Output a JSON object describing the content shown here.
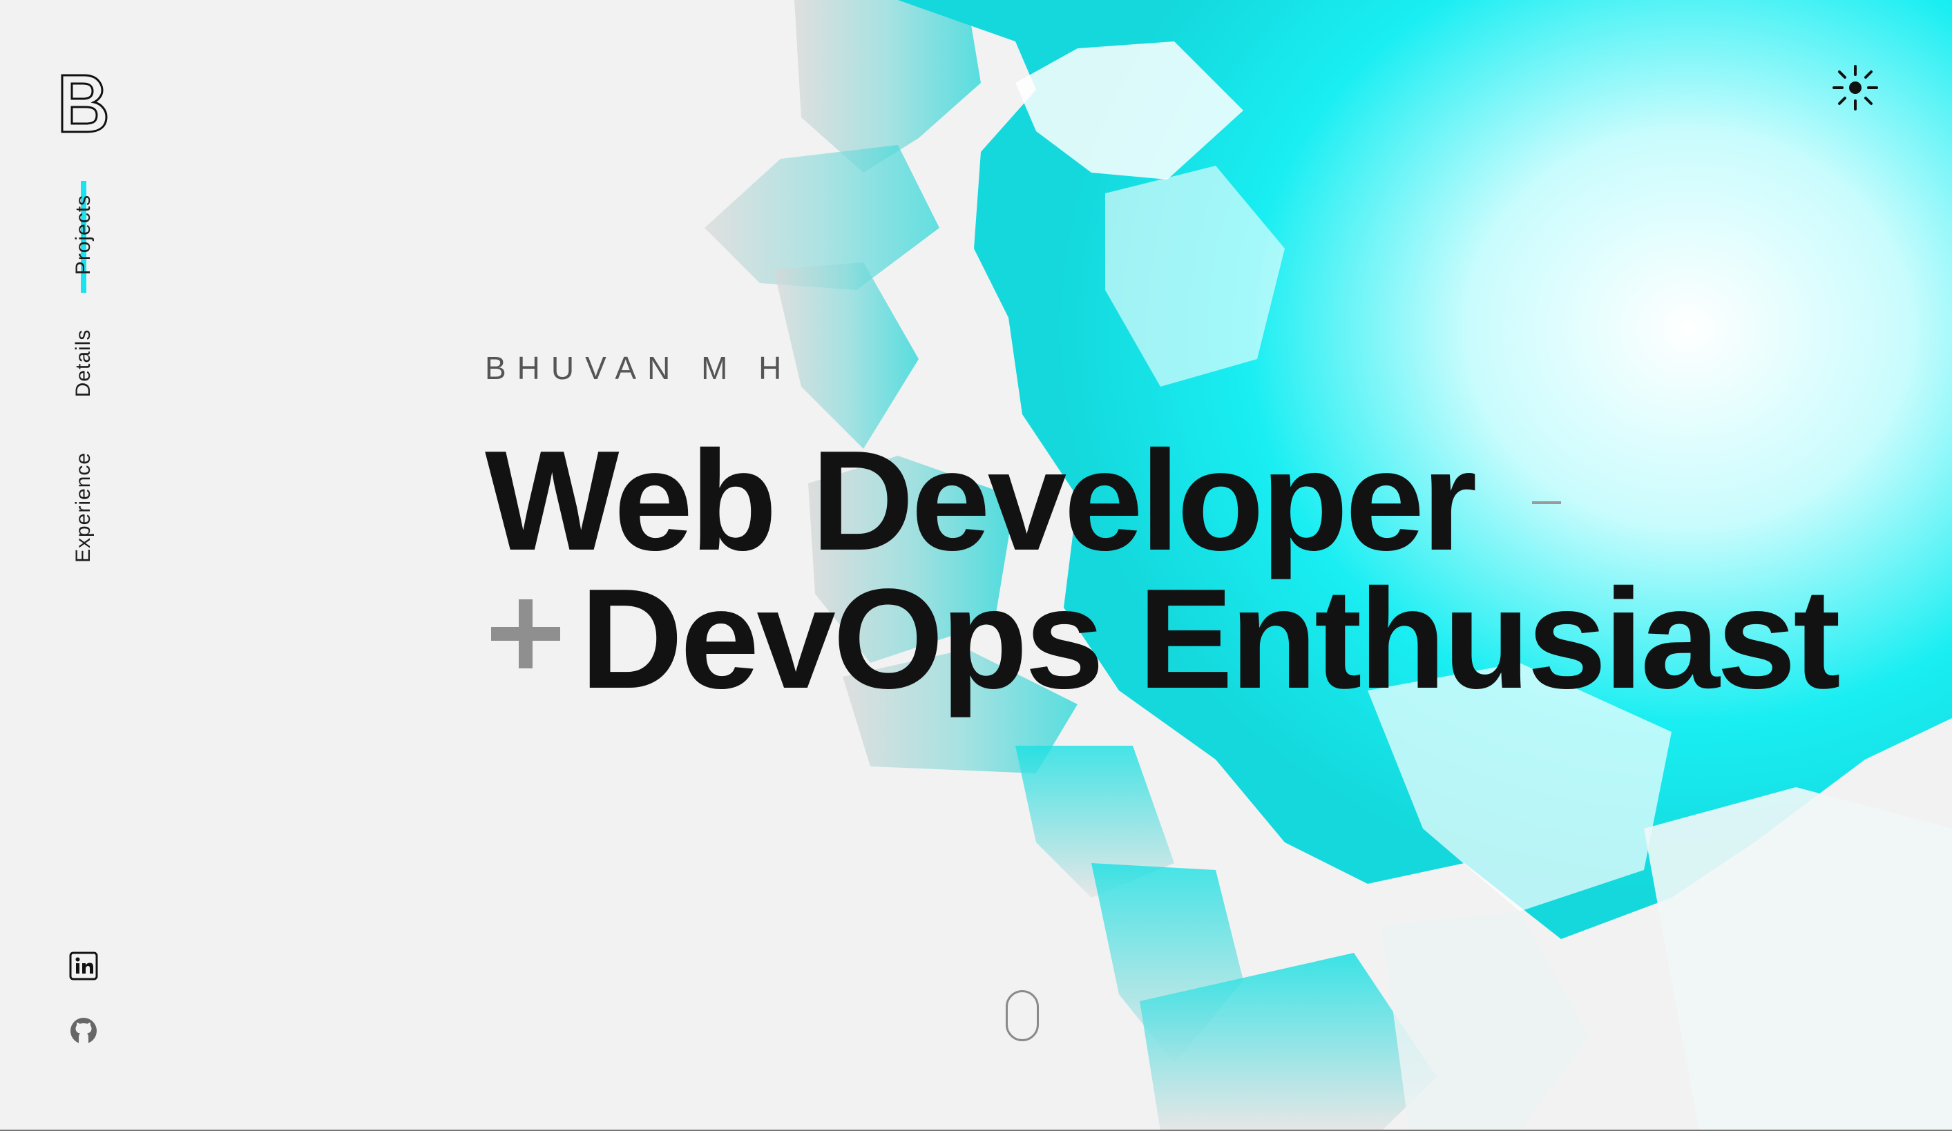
{
  "brand": {
    "logo_letter": "B"
  },
  "nav": {
    "items": [
      {
        "label": "Projects",
        "active": true
      },
      {
        "label": "Details",
        "active": false
      },
      {
        "label": "Experience",
        "active": false
      }
    ]
  },
  "hero": {
    "name": "BHUVAN M H",
    "headline_line1": "Web Developer",
    "headline_line2": "DevOps Enthusiast"
  },
  "social": [
    {
      "icon": "linkedin-icon"
    },
    {
      "icon": "github-icon"
    }
  ],
  "controls": {
    "theme_toggle_icon": "sun-icon",
    "scroll_indicator_icon": "mouse-scroll-icon"
  },
  "colors": {
    "accent": "#19e3ee",
    "text": "#121212",
    "background": "#f2f2f2"
  }
}
